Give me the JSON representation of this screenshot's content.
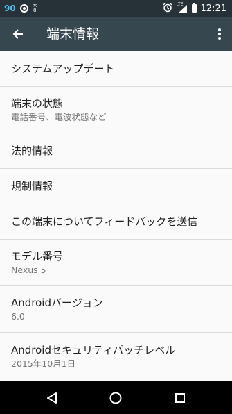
{
  "status_bar": {
    "notification_count": "90",
    "day_kanji_top": "木",
    "day_kanji_bottom": "8",
    "network_label": "LTE",
    "time": "12:21"
  },
  "toolbar": {
    "title": "端末情報",
    "back_icon": "arrow-back-icon",
    "menu_icon": "more-vert-icon"
  },
  "items": [
    {
      "title": "システムアップデート"
    },
    {
      "title": "端末の状態",
      "subtitle": "電話番号、電波状態など"
    },
    {
      "title": "法的情報"
    },
    {
      "title": "規制情報"
    },
    {
      "title": "この端末についてフィードバックを送信"
    },
    {
      "title": "モデル番号",
      "subtitle": "Nexus 5"
    },
    {
      "title": "Androidバージョン",
      "subtitle": "6.0"
    },
    {
      "title": "Androidセキュリティパッチレベル",
      "subtitle": "2015年10月1日"
    }
  ],
  "nav_bar": {
    "back_icon": "nav-back-icon",
    "home_icon": "nav-home-icon",
    "recents_icon": "nav-recents-icon"
  },
  "colors": {
    "status_bar": "#263238",
    "toolbar": "#37474f",
    "background": "#fafafa",
    "accent_number": "#4fc3f7"
  }
}
